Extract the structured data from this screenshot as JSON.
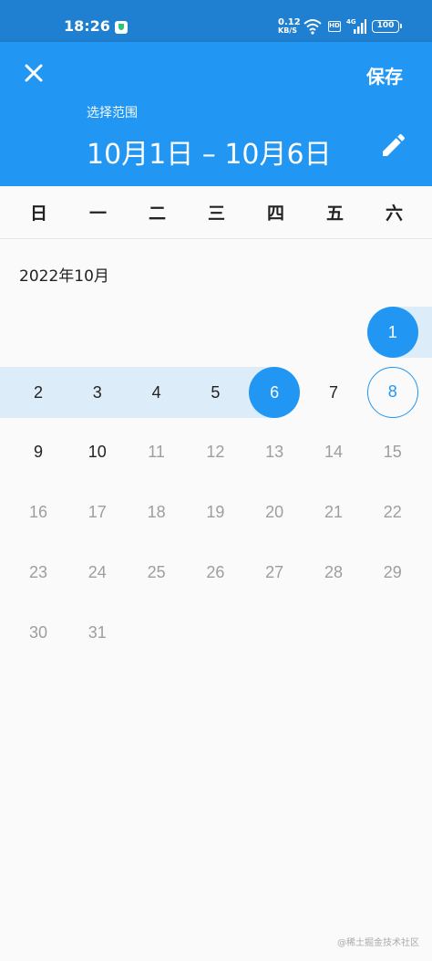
{
  "status_bar": {
    "time": "18:26",
    "net_speed_value": "0.12",
    "net_speed_unit": "KB/S",
    "hd_label": "HD",
    "signal_label": "4G",
    "battery": "100"
  },
  "header": {
    "save_label": "保存",
    "subtitle": "选择范围",
    "range_text": "10月1日 – 10月6日",
    "background_color": "#2196f3"
  },
  "weekdays": [
    "日",
    "一",
    "二",
    "三",
    "四",
    "五",
    "六"
  ],
  "calendar": {
    "month_label": "2022年10月",
    "first_weekday_index": 6,
    "days_in_month": 31,
    "range_start": 1,
    "range_end": 6,
    "today": 8,
    "last_enabled_day": 10,
    "selected_color": "#2196f3",
    "range_color": "#dcecf9"
  },
  "watermark": "@稀土掘金技术社区"
}
